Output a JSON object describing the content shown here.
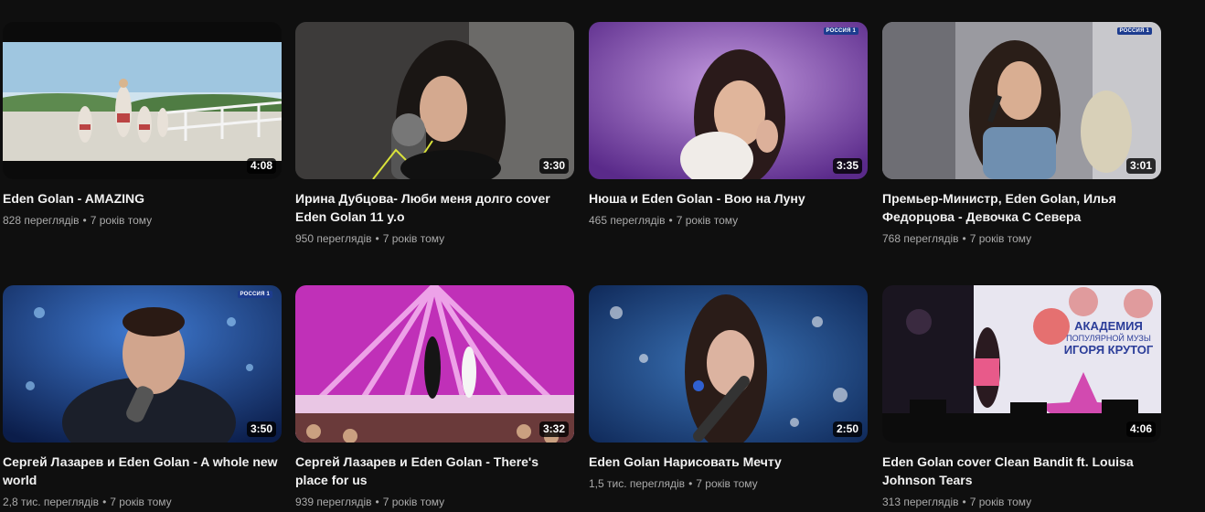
{
  "videos": [
    {
      "title": "Eden Golan - AMAZING",
      "duration": "4:08",
      "views": "828 переглядів",
      "age": "7 років тому"
    },
    {
      "title": "Ирина Дубцова- Люби меня долго cover Eden Golan 11 y.o",
      "duration": "3:30",
      "views": "950 переглядів",
      "age": "7 років тому"
    },
    {
      "title": "Нюша и Eden Golan - Вою на Луну",
      "duration": "3:35",
      "views": "465 переглядів",
      "age": "7 років тому",
      "channel_logo": "РОССИЯ 1"
    },
    {
      "title": "Премьер-Министр, Eden Golan, Илья Федорцова - Девочка С Севера",
      "duration": "3:01",
      "views": "768 переглядів",
      "age": "7 років тому",
      "channel_logo": "РОССИЯ 1"
    },
    {
      "title": "Сергей Лазарев и Eden Golan - A whole new world",
      "duration": "3:50",
      "views": "2,8 тис. переглядів",
      "age": "7 років тому",
      "channel_logo": "РОССИЯ 1"
    },
    {
      "title": "Сергей Лазарев и Eden Golan - There's place for us",
      "duration": "3:32",
      "views": "939 переглядів",
      "age": "7 років тому"
    },
    {
      "title": "Eden Golan Нарисовать Мечту",
      "duration": "2:50",
      "views": "1,5 тис. переглядів",
      "age": "7 років тому"
    },
    {
      "title": "Eden Golan cover Clean Bandit ft. Louisa Johnson Tears",
      "duration": "4:06",
      "views": "313 переглядів",
      "age": "7 років тому",
      "banner": {
        "line1": "АКАДЕМИЯ",
        "line2": "ПОПУЛЯРНОЙ МУЗЫ",
        "line3": "ИГОРЯ КРУТОГ"
      }
    }
  ],
  "meta_separator": "•"
}
